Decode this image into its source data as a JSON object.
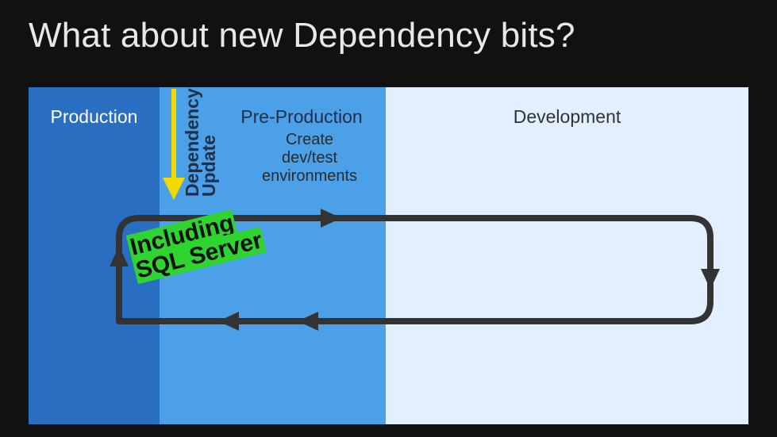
{
  "title": "What about new Dependency bits?",
  "production": {
    "label": "Production"
  },
  "preproduction": {
    "label": "Pre-Production",
    "subtext_line1": "Create",
    "subtext_line2": "dev/test",
    "subtext_line3": "environments"
  },
  "development": {
    "label": "Development"
  },
  "dependency_update": {
    "label_line1": "Dependency",
    "label_line2": "Update"
  },
  "callout": {
    "line1": "Including",
    "line2": "SQL Server"
  }
}
